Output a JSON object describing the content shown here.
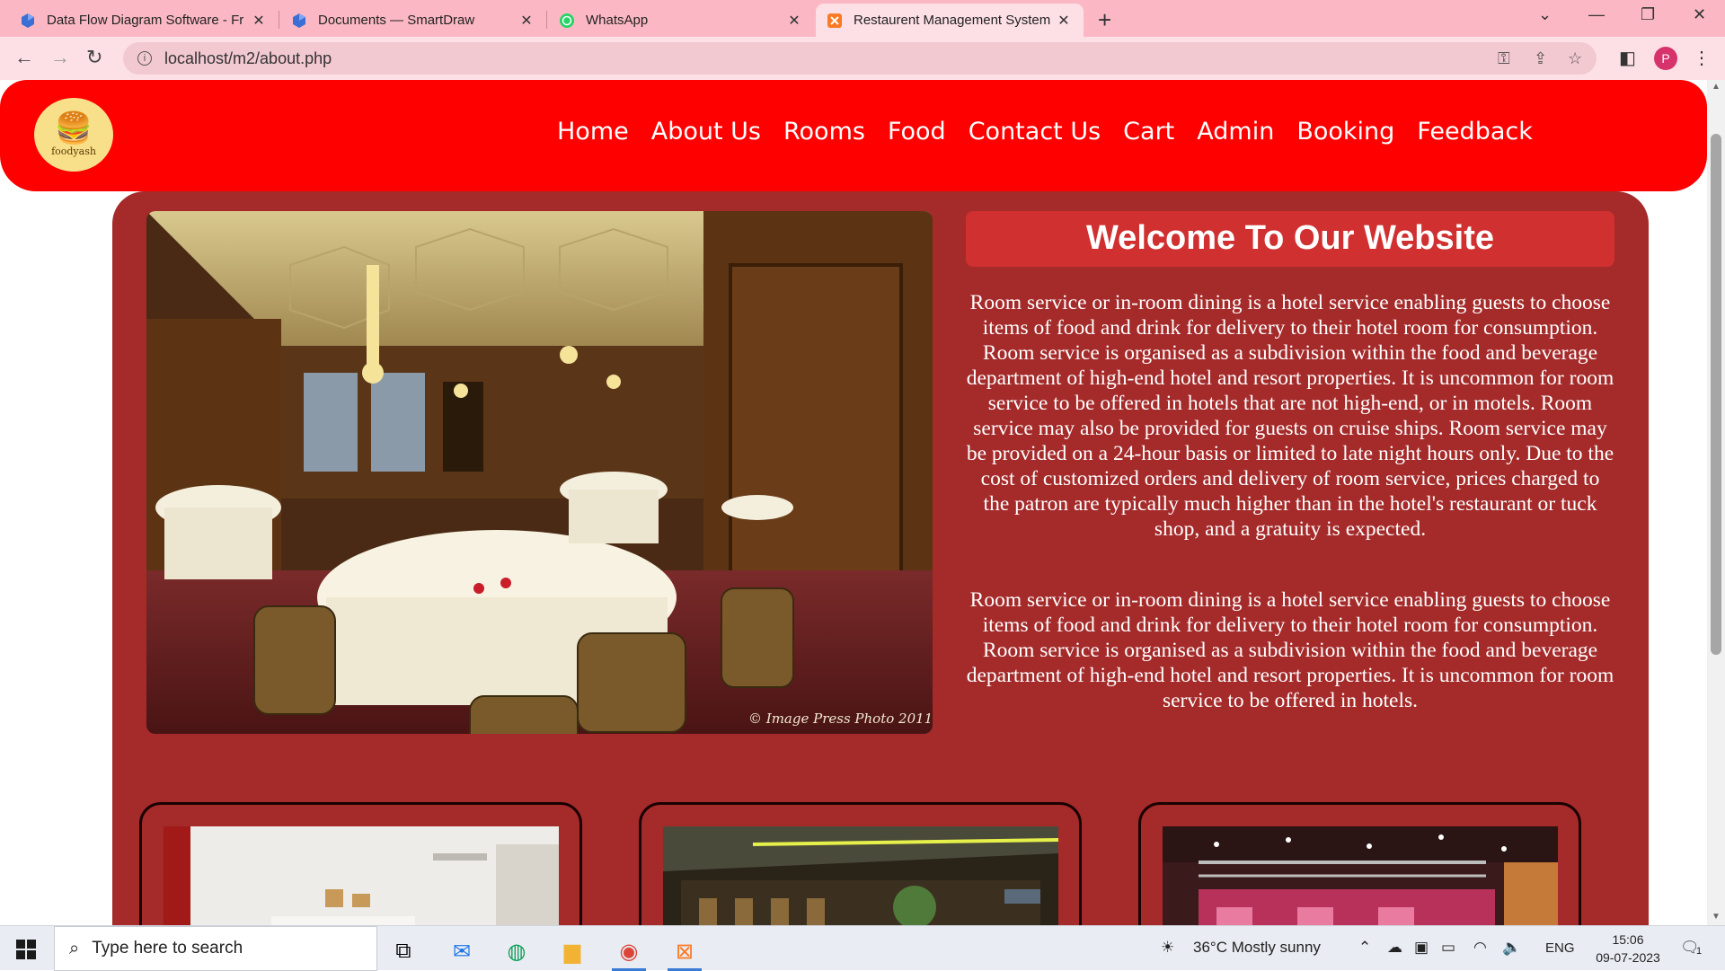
{
  "browser": {
    "tabs": [
      {
        "title": "Data Flow Diagram Software - Fr",
        "icon": "smartdraw-icon",
        "active": false
      },
      {
        "title": "Documents — SmartDraw",
        "icon": "smartdraw-icon",
        "active": false
      },
      {
        "title": "WhatsApp",
        "icon": "whatsapp-icon",
        "active": false
      },
      {
        "title": "Restaurent Management System",
        "icon": "xampp-icon",
        "active": true
      }
    ],
    "new_tab": "+",
    "url": "localhost/m2/about.php",
    "profile_initial": "P"
  },
  "site": {
    "logo_text": "foodyash",
    "nav": [
      "Home",
      "About Us",
      "Rooms",
      "Food",
      "Contact Us",
      "Cart",
      "Admin",
      "Booking",
      "Feedback"
    ],
    "welcome_title": "Welcome To Our Website",
    "para1": "Room service or in-room dining is a hotel service enabling guests to choose items of food and drink for delivery to their hotel room for consumption. Room service is organised as a subdivision within the food and beverage department of high-end hotel and resort properties. It is uncommon for room service to be offered in hotels that are not high-end, or in motels. Room service may also be provided for guests on cruise ships. Room service may be provided on a 24-hour basis or limited to late night hours only. Due to the cost of customized orders and delivery of room service, prices charged to the patron are typically much higher than in the hotel's restaurant or tuck shop, and a gratuity is expected.",
    "para2": "Room service or in-room dining is a hotel service enabling guests to choose items of food and drink for delivery to their hotel room for consumption. Room service is organised as a subdivision within the food and beverage department of high-end hotel and resort properties. It is uncommon for room service to be offered in hotels.",
    "photo_credit": "© Image Press Photo 2011"
  },
  "taskbar": {
    "search_placeholder": "Type here to search",
    "weather": "36°C  Mostly sunny",
    "lang": "ENG",
    "time": "15:06",
    "date": "09-07-2023",
    "notifications": "1"
  },
  "colors": {
    "header": "#ff0000",
    "panel": "#a52a2a",
    "welcome_bg": "#d03030",
    "tabbar": "#fbb8c4"
  }
}
